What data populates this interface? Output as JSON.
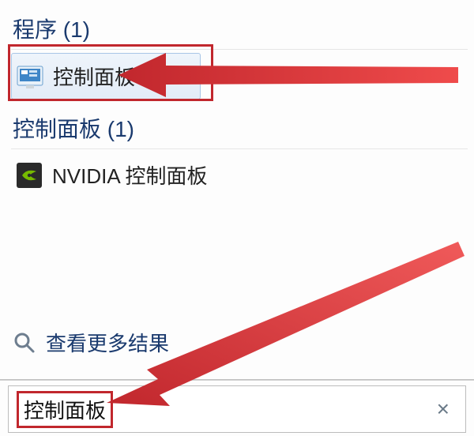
{
  "categories": [
    {
      "header": "程序 (1)",
      "items": [
        {
          "label": "控制面板",
          "icon": "control-panel-icon",
          "selected": true
        }
      ]
    },
    {
      "header": "控制面板 (1)",
      "items": [
        {
          "label": "NVIDIA 控制面板",
          "icon": "nvidia-icon",
          "selected": false
        }
      ]
    }
  ],
  "more_results_label": "查看更多结果",
  "search": {
    "value": "控制面板",
    "clear_glyph": "×"
  }
}
